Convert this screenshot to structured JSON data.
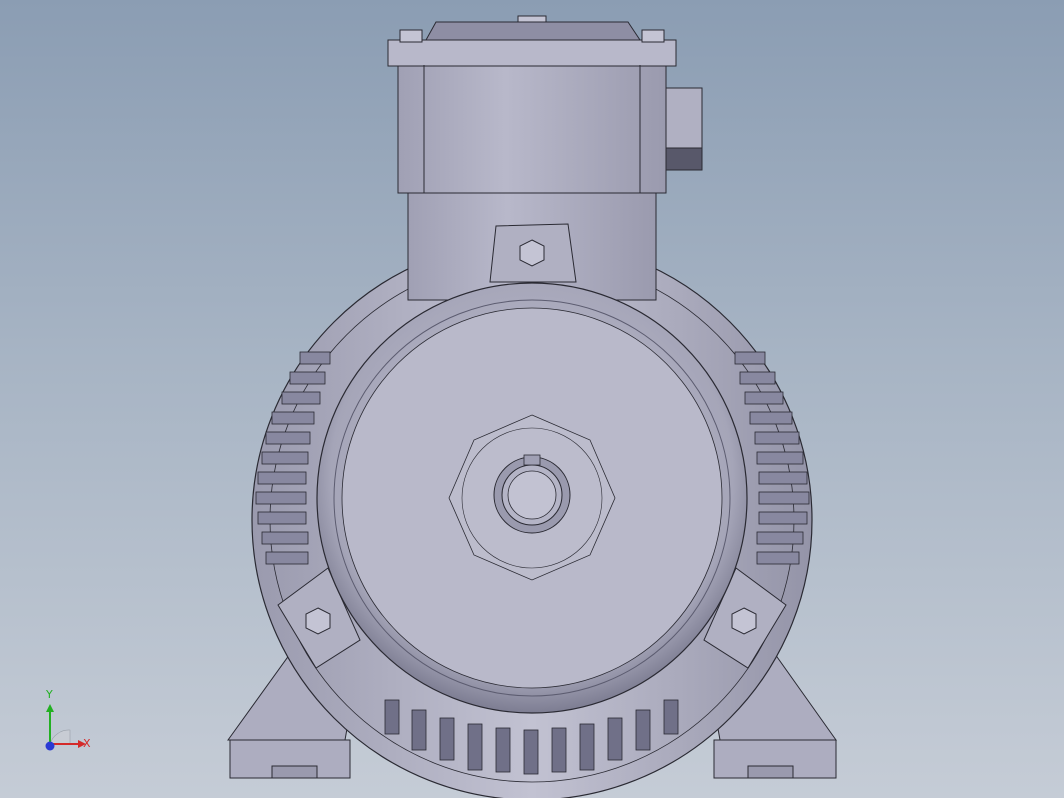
{
  "viewport": {
    "background_top": "#8b9db3",
    "background_bottom": "#c5ccd6",
    "model_fill": "#b6b6c8",
    "model_stroke": "#2a2a33"
  },
  "triad": {
    "x_label": "X",
    "y_label": "Y",
    "x_color": "#d42a2a",
    "y_color": "#22b022",
    "z_color": "#2a3ad4"
  },
  "model": {
    "icon": "electric-motor-front-view"
  }
}
